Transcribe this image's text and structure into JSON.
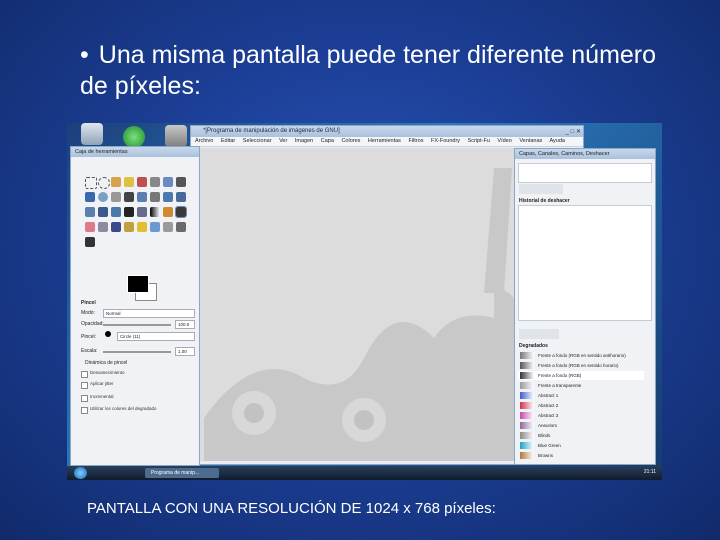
{
  "slide": {
    "bullet": "•",
    "title": "Una misma pantalla puede tener diferente número de píxeles:",
    "caption": "PANTALLA CON UNA RESOLUCIÓN DE 1024 x 768 píxeles:"
  },
  "screenshot": {
    "image_window": {
      "title": "*[Programa de manipulación de imágenes de GNU]",
      "window_buttons": "_ □ ✕",
      "menu": [
        "Archivo",
        "Editar",
        "Seleccionar",
        "Ver",
        "Imagen",
        "Capa",
        "Colores",
        "Herramientas",
        "Filtros",
        "FX-Foundry",
        "Script-Fu",
        "Vídeo",
        "Ventanas",
        "Ayuda"
      ]
    },
    "toolbox": {
      "title": "Caja de herramientas",
      "section": "Pincel",
      "mode_label": "Modo:",
      "mode_value": "Normal",
      "opacity_label": "Opacidad:",
      "opacity_value": "100.0",
      "brush_label": "Pincel:",
      "brush_value": "Circle (11)",
      "scale_label": "Escala:",
      "scale_value": "1.00",
      "dynamics": "Dinámica de pincel",
      "options": [
        "Desvanecimiento",
        "Aplicar jitter",
        "Incremental",
        "Utilizar los colores del degradado"
      ]
    },
    "dock": {
      "title": "Capas, Canales, Caminos, Deshacer",
      "undo_header": "Historial de deshacer",
      "gradients_header": "Degradados",
      "gradients": [
        {
          "name": "Frente a fondo (RGB en sentido antihorario)",
          "color": "#777777"
        },
        {
          "name": "Frente a fondo (RGB en sentido horario)",
          "color": "#555555"
        },
        {
          "name": "Frente a fondo (RGB)",
          "color": "#333333"
        },
        {
          "name": "Frente a transparente",
          "color": "#999999"
        },
        {
          "name": "Abstract 1",
          "color": "#3a5fd0"
        },
        {
          "name": "Abstract 2",
          "color": "#d0304a"
        },
        {
          "name": "Abstract 3",
          "color": "#c04ab0"
        },
        {
          "name": "Aneurism",
          "color": "#8a6a9c"
        },
        {
          "name": "Blinds",
          "color": "#888888"
        },
        {
          "name": "Blue Green",
          "color": "#20a0c0"
        },
        {
          "name": "Browns",
          "color": "#b07a3a"
        }
      ]
    },
    "taskbar": {
      "task": "Programa de manip...",
      "clock": "21:11"
    }
  }
}
